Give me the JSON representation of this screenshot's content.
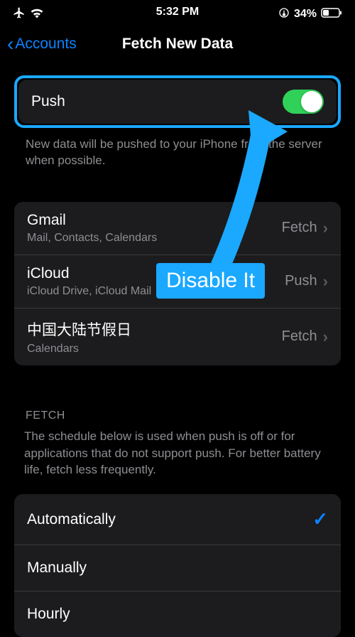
{
  "status_bar": {
    "time": "5:32 PM",
    "battery_percent": "34%"
  },
  "nav": {
    "back_label": "Accounts",
    "title": "Fetch New Data"
  },
  "push": {
    "label": "Push",
    "footer": "New data will be pushed to your iPhone from the server when possible."
  },
  "accounts": [
    {
      "title": "Gmail",
      "subtitle": "Mail, Contacts, Calendars",
      "value": "Fetch"
    },
    {
      "title": "iCloud",
      "subtitle": "iCloud Drive, iCloud Mail",
      "value": "Push"
    },
    {
      "title": "中国大陆节假日",
      "subtitle": "Calendars",
      "value": "Fetch"
    }
  ],
  "fetch": {
    "header": "FETCH",
    "description": "The schedule below is used when push is off or for applications that do not support push. For better battery life, fetch less frequently.",
    "options": [
      {
        "label": "Automatically",
        "selected": true
      },
      {
        "label": "Manually",
        "selected": false
      },
      {
        "label": "Hourly",
        "selected": false
      }
    ]
  },
  "annotation": {
    "label": "Disable It"
  }
}
